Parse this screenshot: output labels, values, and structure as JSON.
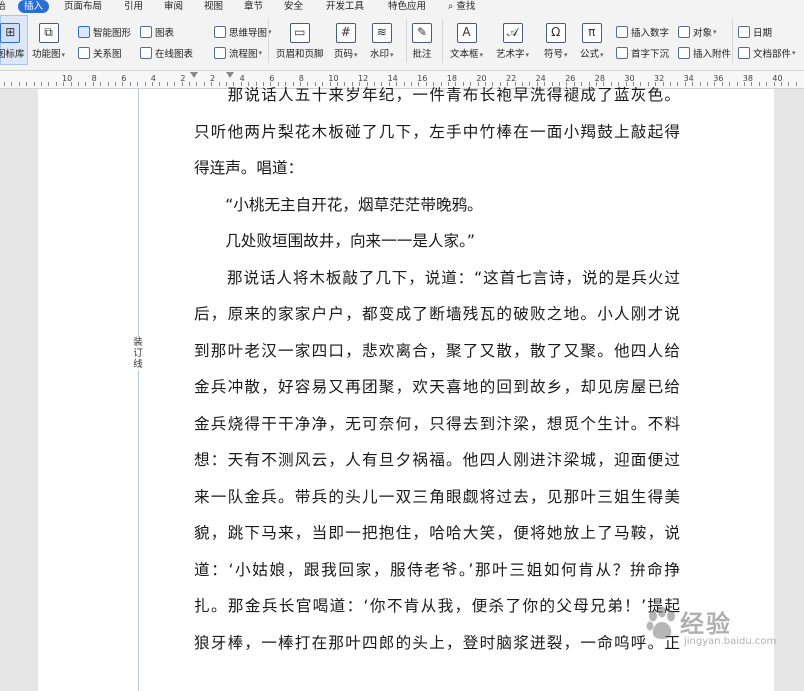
{
  "menu": {
    "tabs": [
      {
        "label": "插入",
        "active": true
      },
      {
        "label": "页面布局"
      },
      {
        "label": "引用"
      },
      {
        "label": "审阅"
      },
      {
        "label": "视图"
      },
      {
        "label": "章节"
      },
      {
        "label": "安全"
      },
      {
        "label": "开发工具"
      },
      {
        "label": "特色应用"
      },
      {
        "label": "查找"
      }
    ],
    "search_icon": "search-icon",
    "accent_color": "#2b6fd6"
  },
  "ribbon": {
    "icon_library": "图标库",
    "function_chart": "功能图",
    "smart_shape": "智能图形",
    "relation_chart": "关系图",
    "chart": "图表",
    "online_chart": "在线图表",
    "mind_map": "思维导图",
    "flow_chart": "流程图",
    "header_footer": "页眉和页脚",
    "page_number": "页码",
    "watermark": "水印",
    "comment": "批注",
    "text_box": "文本框",
    "art_text": "艺术字",
    "symbol": "符号",
    "formula": "公式",
    "insert_number": "插入数字",
    "drop_cap": "首字下沉",
    "object": "对象",
    "insert_attachment": "插入附件",
    "date": "日期",
    "doc_parts": "文档部件"
  },
  "ruler": {
    "numbers": [
      "10",
      "8",
      "6",
      "4",
      "2",
      "2",
      "4",
      "6",
      "8",
      "10",
      "12",
      "14",
      "16",
      "18",
      "20",
      "22",
      "24",
      "26",
      "28",
      "30",
      "32",
      "34",
      "36",
      "38",
      "40"
    ]
  },
  "document": {
    "gutter_label": "装订线",
    "lines": [
      "　　那说话人五十来岁年纪，一件青布长袍早洗得褪成了蓝灰色。",
      "只听他两片梨花木板碰了几下，左手中竹棒在一面小羯鼓上敲起得",
      "得连声。唱道：",
      "　　“小桃无主自开花，烟草茫茫带晚鸦。",
      "　　几处败垣围故井，向来一一是人家。”",
      "　　那说话人将木板敲了几下，说道：“这首七言诗，说的是兵火过",
      "后，原来的家家户户，都变成了断墙残瓦的破败之地。小人刚才说",
      "到那叶老汉一家四口，悲欢离合，聚了又散，散了又聚。他四人给",
      "金兵冲散，好容易又再团聚，欢天喜地的回到故乡，却见房屋已给",
      "金兵烧得干干净净，无可奈何，只得去到汴梁，想觅个生计。不料",
      "想：天有不测风云，人有旦夕祸福。他四人刚进汴梁城，迎面便过",
      "来一队金兵。带兵的头儿一双三角眼觑将过去，见那叶三姐生得美",
      "貌，跳下马来，当即一把抱住，哈哈大笑，便将她放上了马鞍，说",
      "道：‘小姑娘，跟我回家，服侍老爷。’那叶三姐如何肯从？拚命挣",
      "扎。那金兵长官喝道：‘你不肯从我，便杀了你的父母兄弟！’提起",
      "狼牙棒，一棒打在那叶四郎的头上，登时脑浆迸裂，一命呜呼。正"
    ],
    "last_line_indices": [
      2,
      3,
      4
    ]
  },
  "watermark": {
    "text": "经验",
    "sub": "jingyan.baidu.com"
  }
}
